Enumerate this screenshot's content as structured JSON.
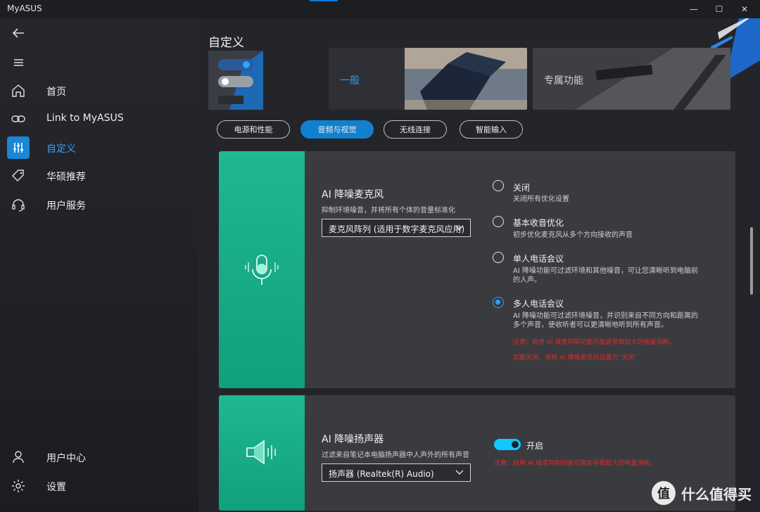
{
  "window": {
    "title": "MyASUS",
    "minimize": "—",
    "maximize": "☐",
    "close": "✕"
  },
  "sidebar": {
    "items": [
      {
        "label": "首页",
        "icon": "home-icon"
      },
      {
        "label": "Link to MyASUS",
        "icon": "link-icon"
      },
      {
        "label": "自定义",
        "icon": "sliders-icon"
      },
      {
        "label": "华硕推荐",
        "icon": "tag-icon"
      },
      {
        "label": "用户服务",
        "icon": "headset-icon"
      }
    ],
    "bottom_items": [
      {
        "label": "用户中心",
        "icon": "user-icon"
      },
      {
        "label": "设置",
        "icon": "gear-icon"
      }
    ]
  },
  "main": {
    "title": "自定义",
    "cards": [
      {
        "label": "一般"
      },
      {
        "label": "专属功能"
      }
    ],
    "tabs": [
      {
        "label": "电源和性能"
      },
      {
        "label": "音频与视觉",
        "active": true
      },
      {
        "label": "无线连接"
      },
      {
        "label": "智能输入"
      }
    ]
  },
  "mic_section": {
    "title": "AI 降噪麦克风",
    "desc": "抑制环境噪音，并将所有个体的音量标准化",
    "dropdown_value": "麦克风阵列 (适用于数字麦克风应用)",
    "options": [
      {
        "label": "关闭",
        "desc": "关闭所有优化设置",
        "selected": false
      },
      {
        "label": "基本收音优化",
        "desc": "初步优化麦克风从多个方向接收的声音",
        "selected": false
      },
      {
        "label": "单人电话会议",
        "desc": "AI 降噪功能可过滤环境和其他噪音，可让您清晰听到电脑前的人声。",
        "selected": false
      },
      {
        "label": "多人电话会议",
        "desc": "AI 降噪功能可过滤环境噪音，并识别来自不同方向和距离的多个声音，使收听者可以更清晰地听到所有声音。",
        "selected": true
      }
    ],
    "warning_1": "注意：启用 AI 噪音抑制功能可能会导致较大的电量消耗。",
    "warning_2": "如要关闭，请将 AI 降噪麦克风设置为“关闭”"
  },
  "speaker_section": {
    "title": "AI 降噪扬声器",
    "desc": "过滤来自笔记本电脑扬声器中人声外的所有声音",
    "dropdown_value": "扬声器 (Realtek(R) Audio)",
    "toggle_label": "开启",
    "toggle_on": true,
    "warning": "注意：启用 AI 噪音抑制功能可能会导致较大的电量消耗。"
  },
  "watermark": {
    "badge": "值",
    "text": "什么值得买"
  },
  "colors": {
    "accent": "#1080cf",
    "feature_green": "#10a07c",
    "warning": "#e02b2b",
    "toggle": "#12c7ff"
  }
}
